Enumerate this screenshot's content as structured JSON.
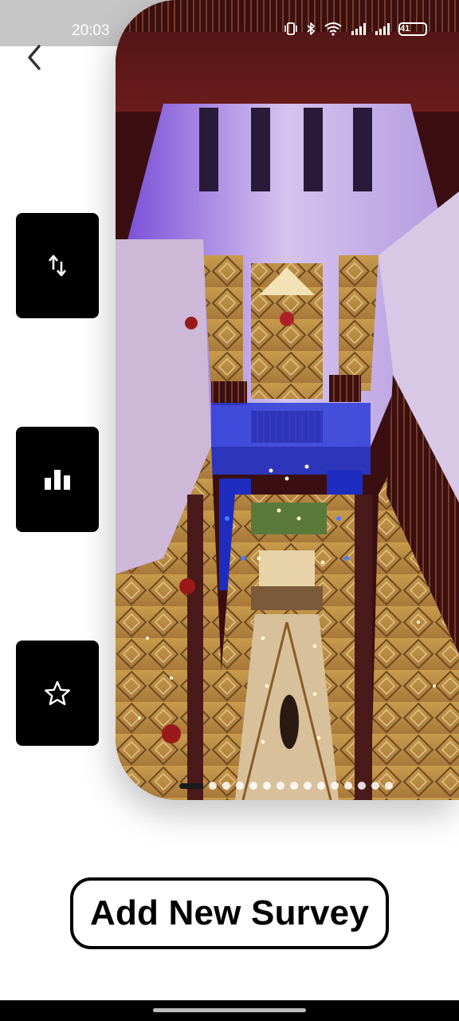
{
  "status_bar": {
    "time": "20:03",
    "battery_level": "41",
    "icons": [
      "vibrate-icon",
      "bluetooth-icon",
      "wifi-icon",
      "signal-icon",
      "signal-icon",
      "battery-icon"
    ]
  },
  "navigation": {
    "back_icon": "chevron-left-icon"
  },
  "side_actions": [
    {
      "icon": "sort-arrows-icon"
    },
    {
      "icon": "bar-chart-icon"
    },
    {
      "icon": "star-outline-icon"
    }
  ],
  "gallery": {
    "image_subject": "hotel atrium interior viewed from above",
    "page_count": 15,
    "active_index": 0
  },
  "actions": {
    "add_survey_label": "Add New Survey"
  },
  "colors": {
    "status_bar_bg": "#c6c6c6",
    "button_bg": "#000000",
    "page_bg": "#ffffff",
    "accent_purple": "#8a3ee0",
    "accent_blue": "#2b3cd8"
  }
}
